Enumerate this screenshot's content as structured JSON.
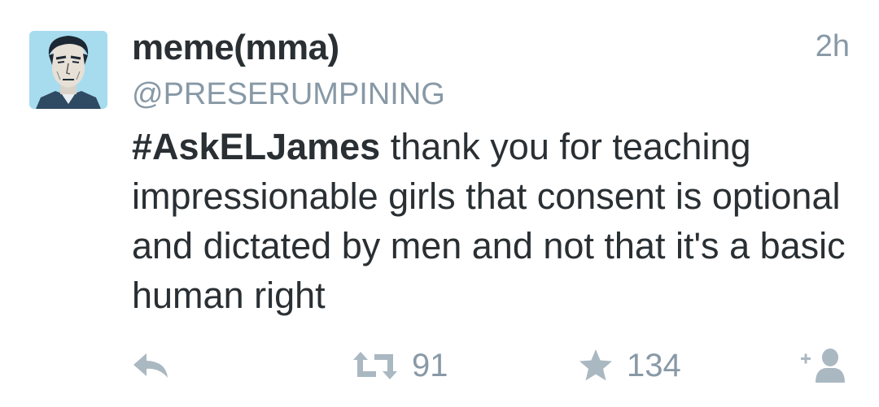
{
  "tweet": {
    "display_name": "meme(mma)",
    "handle": "@PRESERUMPINING",
    "timestamp": "2h",
    "hashtag": "#AskELJames",
    "text_rest": " thank you for teaching impressionable girls that consent is optional and dictated by men and not that it's a basic human right"
  },
  "actions": {
    "retweet_count": "91",
    "favorite_count": "134"
  },
  "colors": {
    "text": "#292f33",
    "muted": "#8899a6",
    "icon": "#aab8c2",
    "avatar_bg": "#a7dcef"
  },
  "icons": {
    "reply": "reply-arrow-icon",
    "retweet": "retweet-icon",
    "favorite": "star-icon",
    "follow": "follow-user-icon"
  }
}
